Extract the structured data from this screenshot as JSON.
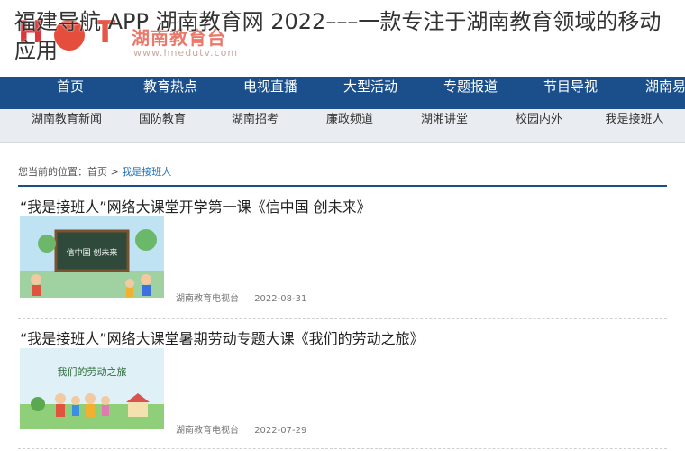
{
  "overlay_title": "福建导航 APP 湖南教育网 2022–––一款专注于湖南教育领域的移动应用",
  "header": {
    "logo_letters": [
      "H",
      "E",
      "T"
    ],
    "logo_text": "湖南教育台",
    "logo_url": "www.hnedutv.com"
  },
  "nav": {
    "items": [
      "首页",
      "教育热点",
      "电视直播",
      "大型活动",
      "专题报道",
      "节目导视",
      "湖南易"
    ]
  },
  "subnav": {
    "items": [
      "湖南教育新闻",
      "国防教育",
      "湖南招考",
      "廉政频道",
      "湖湘讲堂",
      "校园内外",
      "我是接班人"
    ]
  },
  "breadcrumb": {
    "prefix": "您当前的位置：",
    "home": "首页",
    "sep": ">",
    "current": "我是接班人"
  },
  "articles": [
    {
      "title": "“我是接班人”网络大课堂开学第一课《信中国 创未来》",
      "thumb_text": "信中国 创未来",
      "source": "湖南教育电视台",
      "date": "2022-08-31"
    },
    {
      "title": "“我是接班人”网络大课堂暑期劳动专题大课《我们的劳动之旅》",
      "thumb_text": "我们的劳动之旅",
      "source": "湖南教育电视台",
      "date": "2022-07-29"
    }
  ],
  "colors": {
    "nav_bg": "#1a4f8b",
    "subnav_bg": "#e9edf1",
    "accent": "#1a6fb8",
    "logo_red": "#e23a28"
  }
}
